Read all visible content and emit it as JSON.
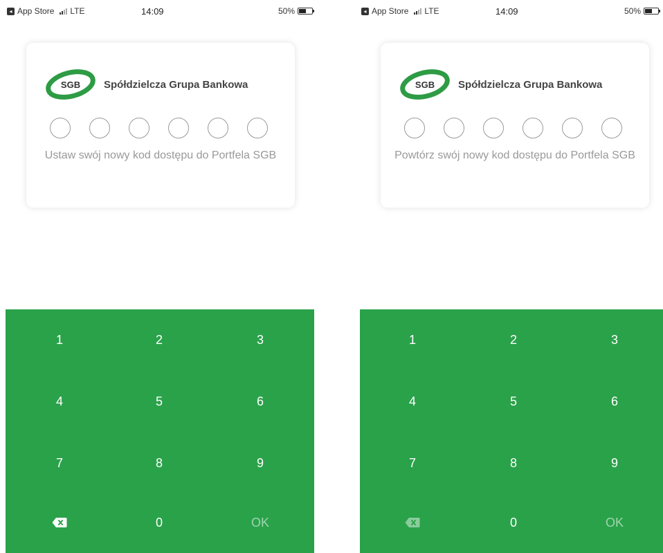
{
  "screens": [
    {
      "status": {
        "carrier": "App Store",
        "network": "LTE",
        "time": "14:09",
        "battery": "50%"
      },
      "bank_name": "Spółdzielcza Grupa Bankowa",
      "logo_text": "SGB",
      "instruction": "Ustaw swój nowy kod dostępu do Portfela SGB",
      "pin_length": 6,
      "keypad": {
        "keys": [
          "1",
          "2",
          "3",
          "4",
          "5",
          "6",
          "7",
          "8",
          "9",
          "0"
        ],
        "ok": "OK"
      }
    },
    {
      "status": {
        "carrier": "App Store",
        "network": "LTE",
        "time": "14:09",
        "battery": "50%"
      },
      "bank_name": "Spółdzielcza Grupa Bankowa",
      "logo_text": "SGB",
      "instruction": "Powtórz swój nowy kod dostępu do Portfela SGB",
      "pin_length": 6,
      "keypad": {
        "keys": [
          "1",
          "2",
          "3",
          "4",
          "5",
          "6",
          "7",
          "8",
          "9",
          "0"
        ],
        "ok": "OK"
      }
    }
  ],
  "colors": {
    "keypad": "#2aa24a",
    "logo_green": "#2e9b45",
    "muted_text": "#999999"
  },
  "icons": {
    "backspace": "backspace-icon",
    "app_store": "app-store-icon",
    "signal": "signal-icon",
    "battery": "battery-icon"
  }
}
